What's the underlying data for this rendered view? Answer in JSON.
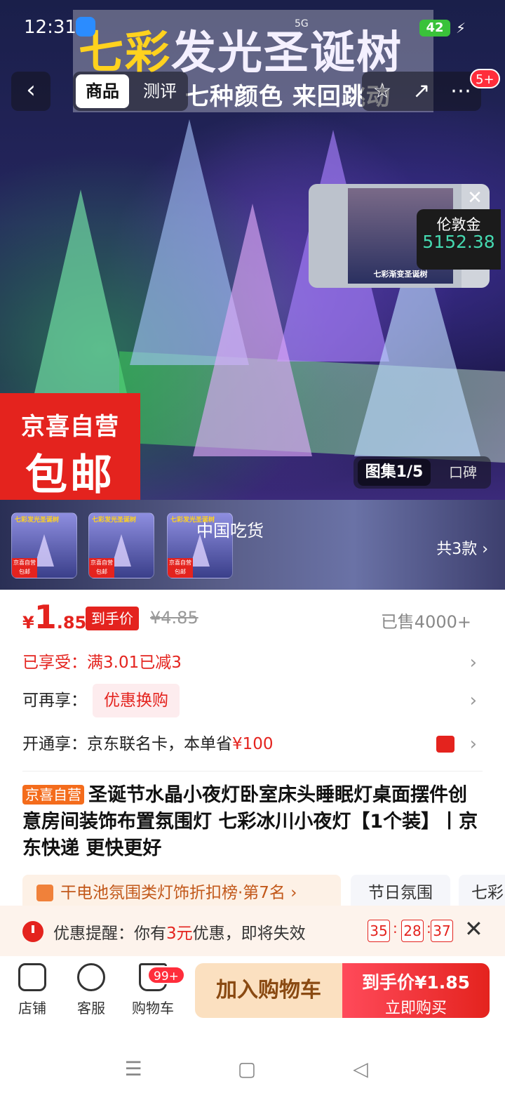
{
  "status": {
    "time": "12:31",
    "signal": "5G",
    "battery": "42"
  },
  "hero": {
    "title_yellow": "七彩",
    "title_white": "发光圣诞树",
    "subtitle": "七种颜色 来回跳动",
    "promo_line1": "京喜自营",
    "promo_line2": "包邮",
    "gallery": "图集1/5",
    "reviews_tab": "口碑"
  },
  "nav": {
    "back_icon": "chevron-left-icon",
    "tabs": [
      "商品",
      "测评"
    ],
    "actions": [
      "star-icon",
      "share-icon",
      "more-icon"
    ],
    "msg_badge": "5+"
  },
  "pip": {
    "caption": "七彩渐变圣诞树",
    "coin_label": "伦敦金",
    "coin_value": "5152.38"
  },
  "sku": {
    "thumb_title": "七彩发光圣诞树",
    "thumb_promo": "京喜自营 包邮",
    "overlay": "中国吃货",
    "more": "共3款 ›"
  },
  "price": {
    "currency": "¥",
    "int": "1",
    "dec": ".85",
    "tag": "到手价",
    "original": "¥4.85",
    "sold": "已售4000+"
  },
  "offers": {
    "row1": "已享受：满3.01已减3",
    "row2_label": "可再享：",
    "row2_pill": "优惠换购",
    "row3_label": "开通享：京东联名卡，本单省",
    "row3_amount": "¥100"
  },
  "product": {
    "badge": "京喜自营",
    "title": "圣诞节水晶小夜灯卧室床头睡眠灯桌面摆件创意房间装饰布置氛围灯 七彩冰川小夜灯【1个装】丨京东快递 更快更好"
  },
  "tags": {
    "rank": "干电池氛围类灯饰折扣榜·第7名 ›",
    "tag2": "节日氛围",
    "tag3": "七彩"
  },
  "reminder": {
    "prefix": "优惠提醒：你有",
    "amount": "3元",
    "suffix": "优惠，即将失效",
    "h": "35",
    "m": "28",
    "s": "37"
  },
  "bottom": {
    "store": "店铺",
    "service": "客服",
    "cart": "购物车",
    "cart_badge": "99+",
    "add_cart": "加入购物车",
    "buy_line1": "到手价¥1.85",
    "buy_line2": "立即购买"
  },
  "system_nav": [
    "menu-icon",
    "home-icon",
    "back-icon"
  ],
  "colors": {
    "brand_red": "#e4231e",
    "coin_green": "#45d9b0",
    "promo_orange": "#f46c1c"
  }
}
